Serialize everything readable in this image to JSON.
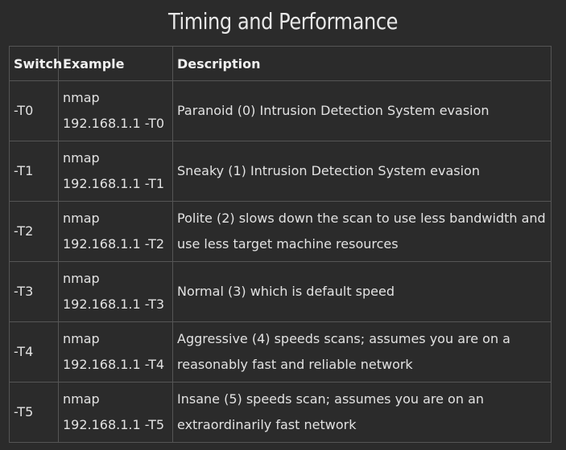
{
  "title": "Timing and Performance",
  "headers": {
    "switch": "Switch",
    "example": "Example",
    "description": "Description"
  },
  "rows": [
    {
      "switch": "-T0",
      "example_cmd": "nmap",
      "example_arg": "192.168.1.1 -T0",
      "description": "Paranoid (0) Intrusion Detection System evasion"
    },
    {
      "switch": "-T1",
      "example_cmd": "nmap",
      "example_arg": "192.168.1.1 -T1",
      "description": "Sneaky (1) Intrusion Detection System evasion"
    },
    {
      "switch": "-T2",
      "example_cmd": "nmap",
      "example_arg": "192.168.1.1 -T2",
      "description": "Polite (2) slows down the scan to use less bandwidth and use less target machine resources"
    },
    {
      "switch": "-T3",
      "example_cmd": "nmap",
      "example_arg": "192.168.1.1 -T3",
      "description": "Normal (3) which is default speed"
    },
    {
      "switch": "-T4",
      "example_cmd": "nmap",
      "example_arg": "192.168.1.1 -T4",
      "description": "Aggressive (4) speeds scans; assumes you are on a reasonably fast and reliable network"
    },
    {
      "switch": "-T5",
      "example_cmd": "nmap",
      "example_arg": "192.168.1.1 -T5",
      "description": "Insane (5) speeds scan; assumes you are on an extraordinarily fast network"
    }
  ],
  "colors": {
    "background": "#2b2b2b",
    "border": "#555555",
    "text": "#e2e2e2"
  }
}
